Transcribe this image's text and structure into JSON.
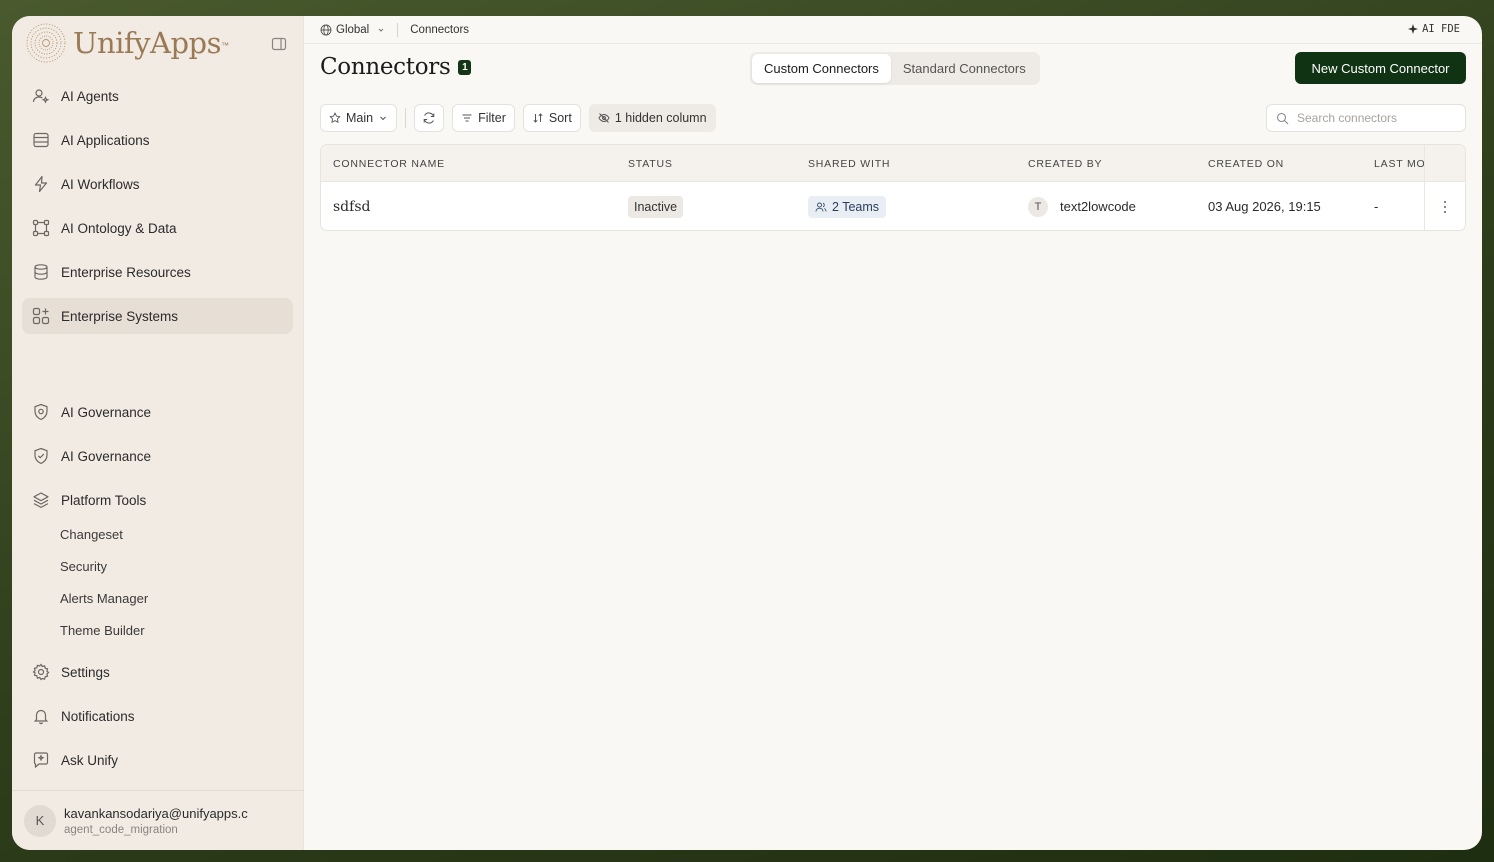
{
  "app": {
    "logo_text": "UnifyApps",
    "logo_tm": "™"
  },
  "sidebar": {
    "items": [
      {
        "label": "AI Agents",
        "icon": "user-sparkle-icon"
      },
      {
        "label": "AI Applications",
        "icon": "window-icon"
      },
      {
        "label": "AI Workflows",
        "icon": "bolt-icon"
      },
      {
        "label": "AI Ontology & Data",
        "icon": "graph-nodes-icon"
      },
      {
        "label": "Enterprise Resources",
        "icon": "database-icon"
      },
      {
        "label": "Enterprise Systems",
        "icon": "grid-plus-icon",
        "active": true
      },
      {
        "label": "AI Governance",
        "icon": "shield-gear-icon"
      },
      {
        "label": "AI Governance",
        "icon": "shield-check-icon"
      },
      {
        "label": "Platform Tools",
        "icon": "layers-icon"
      },
      {
        "label": "Settings",
        "icon": "gear-icon"
      },
      {
        "label": "Notifications",
        "icon": "bell-icon"
      },
      {
        "label": "Ask Unify",
        "icon": "chat-sparkle-icon"
      }
    ],
    "sub_items": [
      "Changeset",
      "Security",
      "Alerts Manager",
      "Theme Builder"
    ],
    "user": {
      "initial": "K",
      "email": "kavankansodariya@unifyapps.c",
      "org": "agent_code_migration"
    }
  },
  "topbar": {
    "scope": "Global",
    "crumb": "Connectors",
    "ai_fde": "AI FDE"
  },
  "page": {
    "title": "Connectors",
    "count": "1",
    "tabs": [
      {
        "label": "Custom Connectors",
        "active": true
      },
      {
        "label": "Standard Connectors",
        "active": false
      }
    ],
    "new_button": "New Custom Connector"
  },
  "toolbar": {
    "view": "Main",
    "filter": "Filter",
    "sort": "Sort",
    "hidden_columns": "1 hidden column",
    "search_placeholder": "Search connectors"
  },
  "table": {
    "columns": [
      "CONNECTOR NAME",
      "STATUS",
      "SHARED WITH",
      "CREATED BY",
      "CREATED ON",
      "LAST MO"
    ],
    "rows": [
      {
        "name": "sdfsd",
        "status": "Inactive",
        "shared_with": "2 Teams",
        "created_by_initial": "T",
        "created_by": "text2lowcode",
        "created_on": "03 Aug 2026, 19:15",
        "last_modified": "-"
      }
    ]
  },
  "colors": {
    "accent": "#0f3313",
    "sidebar_bg": "#f2ebe4",
    "logo": "#9a7a55"
  }
}
